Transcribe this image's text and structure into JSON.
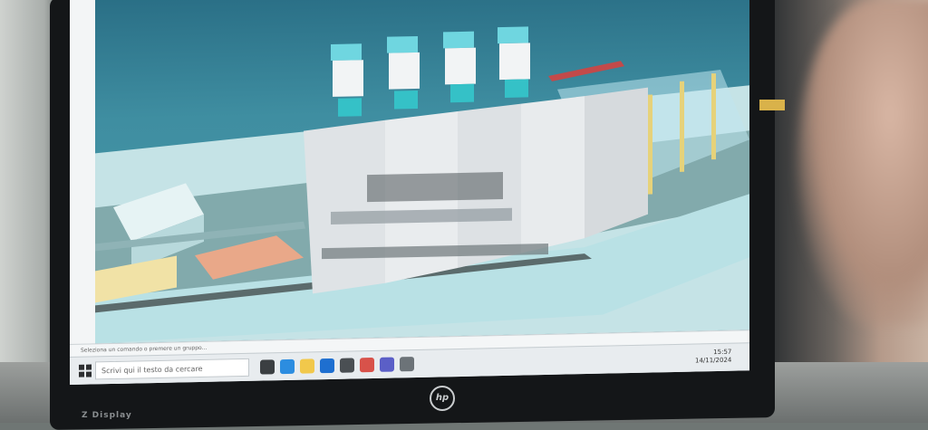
{
  "status_bar": {
    "text": "Seleziona un comando o premere un gruppo..."
  },
  "taskbar": {
    "search_placeholder": "Scrivi qui il testo da cercare",
    "time": "15:57",
    "date": "14/11/2024",
    "icons": [
      "start-icon",
      "task-view-icon",
      "edge-icon",
      "folder-icon",
      "mail-icon",
      "store-icon",
      "app-icon",
      "teams-icon",
      "settings-icon"
    ]
  },
  "brand": {
    "logo": "hp",
    "display_label": "Z Display"
  },
  "colors": {
    "sky": "#2a6f86",
    "floor": "#cfe7ea",
    "machine": "#e2e5e7",
    "accent_cyan": "#4fd0d6",
    "frame_yellow": "#e6d27a"
  }
}
